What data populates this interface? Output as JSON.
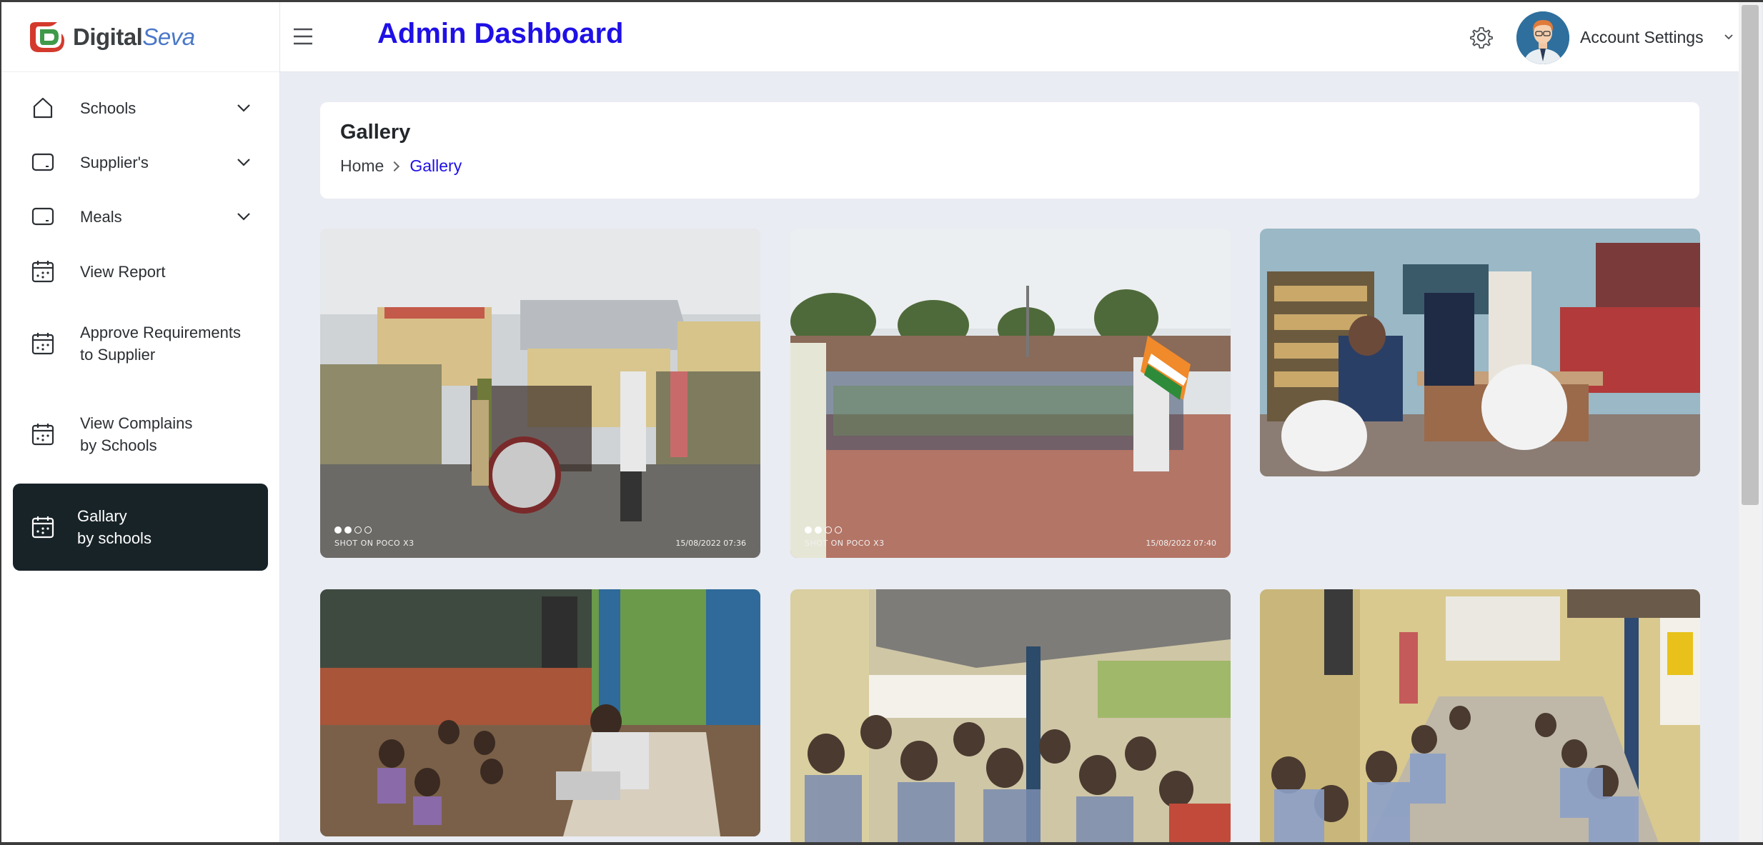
{
  "brand": {
    "name_part1": "Digital",
    "name_part2": "Seva"
  },
  "header": {
    "title": "Admin Dashboard",
    "account_label": "Account Settings"
  },
  "sidebar": {
    "items": [
      {
        "label": "Schools",
        "icon": "home-icon",
        "expandable": true
      },
      {
        "label": "Supplier's",
        "icon": "tablet-icon",
        "expandable": true
      },
      {
        "label": "Meals",
        "icon": "tablet-icon",
        "expandable": true
      },
      {
        "label": "View Report",
        "icon": "calendar-icon"
      },
      {
        "label_line1": "Approve Requirements",
        "label_line2": "to Supplier",
        "icon": "calendar-icon"
      },
      {
        "label_line1": "View Complains",
        "label_line2": "by Schools",
        "icon": "calendar-icon"
      },
      {
        "label_line1": "Gallary",
        "label_line2": "by schools",
        "icon": "calendar-icon",
        "active": true
      }
    ]
  },
  "page": {
    "heading": "Gallery",
    "breadcrumb": {
      "home": "Home",
      "current": "Gallery"
    }
  },
  "gallery": [
    {
      "caption": "SHOT ON POCO X3",
      "timestamp": "15/08/2022  07:36",
      "scene": "school gate with drum"
    },
    {
      "caption": "SHOT ON POCO X3",
      "timestamp": "15/08/2022  07:40",
      "scene": "flag rally in courtyard"
    },
    {
      "scene": "office with officials"
    },
    {
      "scene": "classroom with teacher"
    },
    {
      "scene": "children in corridor"
    },
    {
      "scene": "children seated in verandah"
    }
  ],
  "colors": {
    "accent": "#1f10e6",
    "sidebar_active_bg": "#182328",
    "page_bg": "#e9ecf2"
  }
}
